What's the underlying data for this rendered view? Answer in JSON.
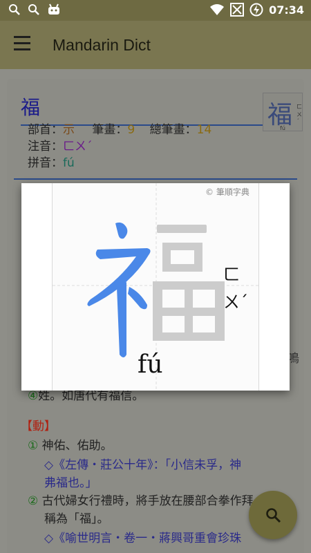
{
  "status_bar": {
    "time": "07:34",
    "icons": [
      "search-icon",
      "search-icon",
      "android-debug-icon",
      "wifi-icon",
      "no-signal-icon",
      "battery-charging-icon"
    ]
  },
  "app_bar": {
    "title": "Mandarin Dict",
    "menu_icon": "hamburger-menu-icon"
  },
  "entry": {
    "character": "福",
    "thumbnail": {
      "character": "福",
      "bopomofo": "ㄈㄨˊ",
      "pinyin": "fú"
    },
    "radical_label": "部首：",
    "radical_value": "示",
    "strokes_label": "筆畫：",
    "strokes_value": "9",
    "total_strokes_label": "總筆畫：",
    "total_strokes_value": "14",
    "zhuyin_label": "注音：",
    "zhuyin_value": "ㄈㄨˊ",
    "pinyin_label": "拼音：",
    "pinyin_value": "fú"
  },
  "definitions": {
    "partial_top_right": "鳴",
    "line_4_prefix": "④",
    "line_4_text": "姓。如唐代有福信。",
    "verb_label": "【動】",
    "verb_defs": [
      {
        "num": "①",
        "text": "神佑、佑助。"
      },
      {
        "num": "",
        "text": "◇《左傳・莊公十年》：「小信未孚，神"
      },
      {
        "num": "",
        "text": "弗福也。」"
      },
      {
        "num": "②",
        "text": "古代婦女行禮時，將手放在腰部合拳作拜"
      },
      {
        "num": "",
        "text": "稱為「福」。"
      },
      {
        "num": "",
        "text": "◇《喻世明言・卷一・蔣興哥重會珍珠"
      }
    ]
  },
  "stroke_dialog": {
    "watermark": "© 筆順字典",
    "character": "福",
    "bopomofo_top": "ㄈ",
    "bopomofo_bottom": "ㄨˊ",
    "pinyin": "fú"
  },
  "fab": {
    "icon": "search-icon"
  },
  "colors": {
    "status_bar": "#6e6a42",
    "app_bar": "#7a7650",
    "stroke_highlight": "#4a88e8",
    "stroke_pending": "#cccccc",
    "fab": "#6e6a3a"
  }
}
